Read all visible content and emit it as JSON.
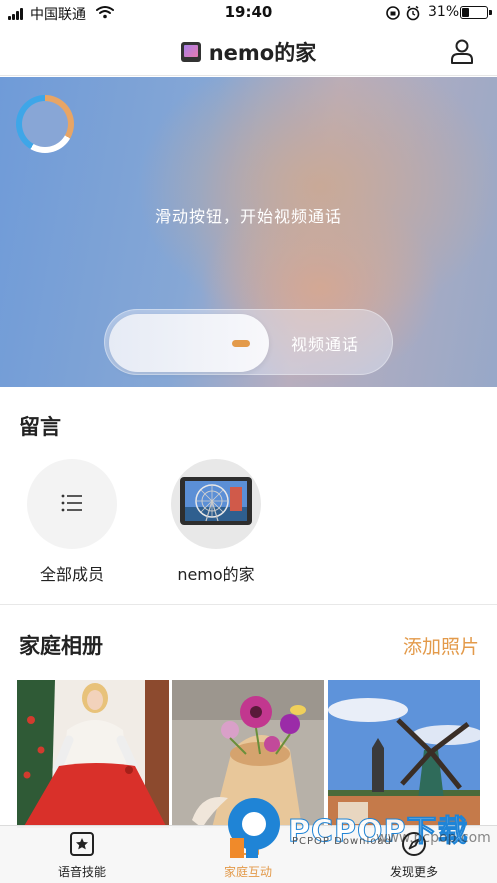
{
  "status_bar": {
    "carrier": "中国联通",
    "time": "19:40",
    "battery_percent": "31%",
    "battery_level": 0.31
  },
  "nav": {
    "title": "nemo的家",
    "home_icon": "home-display-icon",
    "profile_icon": "user-icon"
  },
  "video_call": {
    "hint": "滑动按钮，开始视频通话",
    "slider_label": "视频通话"
  },
  "messages": {
    "title": "留言",
    "members": [
      {
        "name": "全部成员",
        "icon": "list-icon"
      },
      {
        "name": "nemo的家",
        "icon": "device-avatar"
      }
    ]
  },
  "album": {
    "title": "家庭相册",
    "add_label": "添加照片",
    "photos": [
      {
        "icon": "photo-woman-in-red"
      },
      {
        "icon": "photo-flowers-in-eggshell"
      },
      {
        "icon": "photo-windmill"
      }
    ]
  },
  "tab_bar": {
    "tabs": [
      {
        "label": "语音技能",
        "icon": "star-square-icon",
        "active": false
      },
      {
        "label": "家庭互动",
        "icon": "home-interaction-icon",
        "active": true
      },
      {
        "label": "发现更多",
        "icon": "compass-icon",
        "active": false
      }
    ]
  },
  "watermark": {
    "brand": "PCPOP下载",
    "subtitle": "PCPOP Download",
    "url": "www.pcpop.com"
  },
  "colors": {
    "accent": "#e39a4a",
    "text": "#222222",
    "hero_blue": "#6f9bd8"
  }
}
